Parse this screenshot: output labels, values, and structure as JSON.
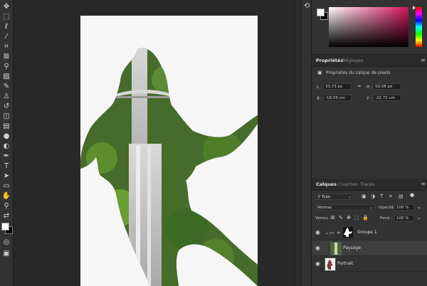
{
  "properties": {
    "tab_properties": "Propriétés",
    "tab_adjustments": "Réglages",
    "subtitle": "Propriétés du calque de pixels",
    "l_label": "L :",
    "l_value": "33,73 po",
    "h_label": "H :",
    "h_value": "50,58 po",
    "x_label": "X :",
    "x_value": "-18,59 cm",
    "y_label": "Y :",
    "y_value": "-22,72 cm"
  },
  "layers": {
    "tab_layers": "Calques",
    "tab_channels": "Couches",
    "tab_paths": "Tracés",
    "filter_type": "Type",
    "blend_mode": "Normal",
    "opacity_label": "Opacité :",
    "opacity_value": "100 %",
    "lock_label": "Verrou :",
    "fill_label": "Fond :",
    "fill_value": "100 %",
    "items": [
      {
        "name": "Groupe 1"
      },
      {
        "name": "Paysage"
      },
      {
        "name": "Portrait"
      }
    ]
  },
  "colors": {
    "foreground": "#ffffff",
    "background": "#000000",
    "accent_hue": "#d4145a"
  },
  "icons": [
    "move-icon",
    "marquee-icon",
    "lasso-icon",
    "magic-wand-icon",
    "crop-icon",
    "frame-icon",
    "eyedropper-icon",
    "healing-icon",
    "brush-icon",
    "stamp-icon",
    "history-brush-icon",
    "eraser-icon",
    "gradient-icon",
    "blur-icon",
    "dodge-icon",
    "pen-icon",
    "type-icon",
    "path-select-icon",
    "rectangle-icon",
    "hand-icon",
    "zoom-icon"
  ]
}
